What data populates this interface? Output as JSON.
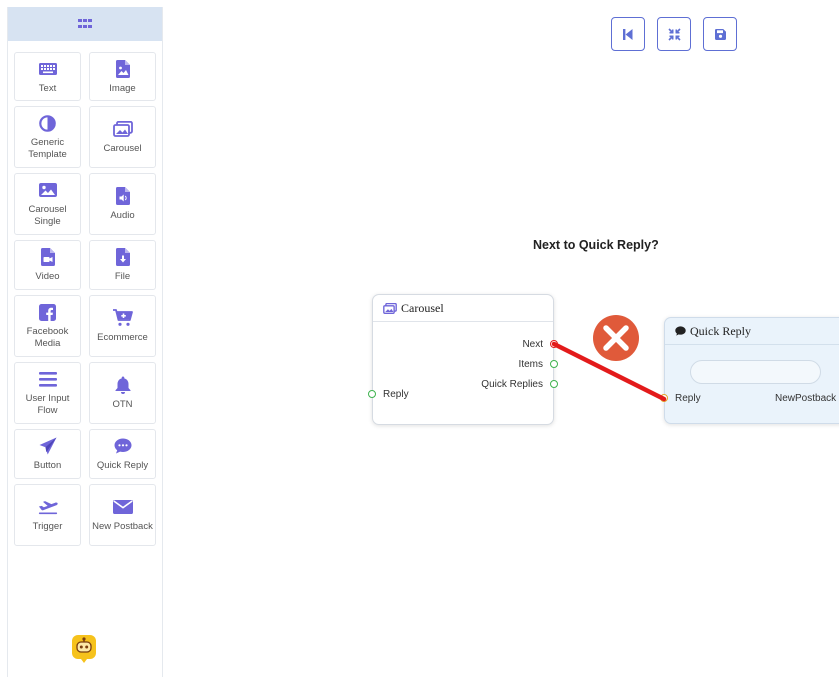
{
  "palette": {
    "items": [
      {
        "label": "Text",
        "icon": "keyboard-icon"
      },
      {
        "label": "Image",
        "icon": "image-file-icon"
      },
      {
        "label": "Generic Template",
        "icon": "half-circle-icon"
      },
      {
        "label": "Carousel",
        "icon": "images-icon"
      },
      {
        "label": "Carousel Single",
        "icon": "image-icon"
      },
      {
        "label": "Audio",
        "icon": "audio-file-icon"
      },
      {
        "label": "Video",
        "icon": "video-file-icon"
      },
      {
        "label": "File",
        "icon": "download-file-icon"
      },
      {
        "label": "Facebook Media",
        "icon": "facebook-icon"
      },
      {
        "label": "Ecommerce",
        "icon": "cart-icon"
      },
      {
        "label": "User Input Flow",
        "icon": "lines-icon"
      },
      {
        "label": "OTN",
        "icon": "bell-icon"
      },
      {
        "label": "Button",
        "icon": "paper-plane-icon"
      },
      {
        "label": "Quick Reply",
        "icon": "chat-bubble-icon"
      },
      {
        "label": "Trigger",
        "icon": "plane-departure-icon"
      },
      {
        "label": "New Postback",
        "icon": "envelope-icon"
      }
    ]
  },
  "toolbar": {
    "buttons": [
      "skip-back-icon",
      "compress-icon",
      "save-icon"
    ]
  },
  "canvas": {
    "question": "Next to Quick Reply?",
    "carousel_node": {
      "title": "Carousel",
      "outputs": [
        "Next",
        "Items",
        "Quick Replies"
      ],
      "input": "Reply"
    },
    "quick_reply_node": {
      "title": "Quick Reply",
      "input": "Reply",
      "output": "NewPostback",
      "text_value": ""
    }
  },
  "colors": {
    "accent": "#6f65d9",
    "sidebar_header": "#d7e3f2",
    "connection": "#e31b1b",
    "error_icon": "#e05a3a",
    "port": "#3fb34f",
    "quick_reply_bg": "#eaf3fb"
  }
}
